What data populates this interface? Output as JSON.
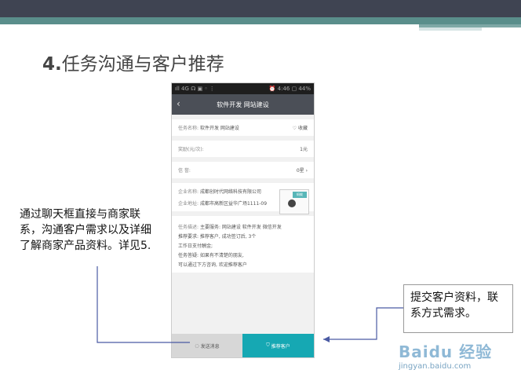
{
  "slide": {
    "title_num": "4.",
    "title_text": "任务沟通与客户推荐"
  },
  "phone": {
    "status_left": "ıll 4G ☊ ▣ ◦ ⋮",
    "status_right": "⏰ 4:46 ▢ 44%",
    "appbar_title": "软件开发 网站建设",
    "task_label": "任务名称:",
    "task_value": "软件开发 网站建设",
    "favorite_label": "收藏",
    "reward_label": "奖励(元/次):",
    "reward_value": "1元",
    "rating_label": "信  誉:",
    "rating_value": "0星",
    "company_label": "企业名称:",
    "company_value": "成都创时代网络科技有限公司",
    "address_label": "企业地址:",
    "address_value": "成都市高新区益华广场1111-09",
    "ant_tag": "蚂蚁",
    "desc_label": "任务描述:",
    "desc_line1": "主要服务: 网站建设 软件开发 微信开发",
    "desc_line2": "推荐要求: 推荐客户, 成功签订后, 3个",
    "desc_line3": "工作日支付酬金;",
    "desc_line4": "任务答疑: 如果有不清楚的朋友,",
    "desc_line5": "可以通过下方咨询, 欢迎推荐客户",
    "bottom_left": "发送消息",
    "bottom_right": "推荐客户"
  },
  "callouts": {
    "left": "通过聊天框直接与商家联系，沟通客户需求以及详细了解商家产品资料。详见5.",
    "right": "提交客户资料，联系方式需求。"
  },
  "watermark": {
    "brand": "Baidu 经验",
    "url": "jingyan.baidu.com"
  }
}
